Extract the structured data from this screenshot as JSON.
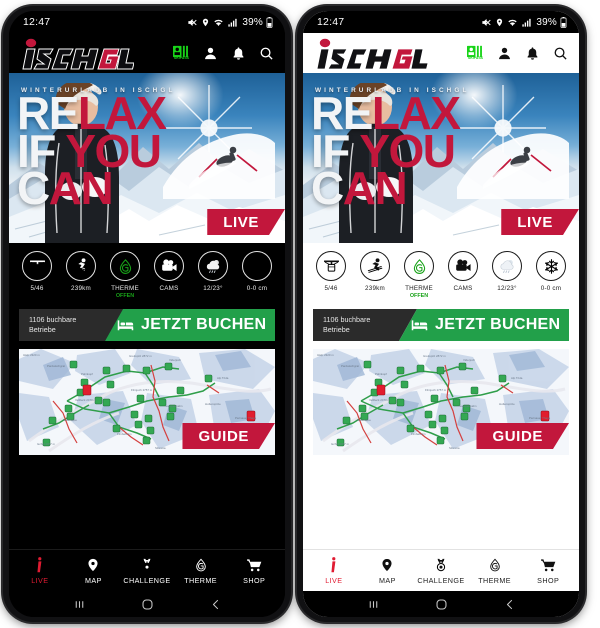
{
  "meta": {
    "layout": "two phone mockups side by side",
    "left_theme": "dark",
    "right_theme": "light"
  },
  "colors": {
    "brand_red": "#c2173c",
    "accent_red": "#e01b32",
    "book_green": "#22a04a",
    "skipass_green": "#18d418",
    "therme_green": "#18a218",
    "dark_bg": "#000000",
    "light_bg": "#ffffff"
  },
  "status_bar": {
    "time": "12:47",
    "battery_percent": "39%",
    "icons": [
      "mute-icon",
      "location-pin-icon",
      "wifi-icon",
      "signal-bars-icon",
      "battery-icon"
    ]
  },
  "app_header": {
    "logo_text": "ISCHGL",
    "icons": [
      {
        "name": "skipass-icon",
        "label": "SKIPASS"
      },
      {
        "name": "account-icon",
        "label": ""
      },
      {
        "name": "notification-bell-icon",
        "label": ""
      },
      {
        "name": "search-icon",
        "label": ""
      }
    ]
  },
  "hero": {
    "eyebrow": "WINTERURLAUB IN ISCHGL",
    "headline_lines": [
      {
        "white": "RE",
        "red": "LAX"
      },
      {
        "white": "IF ",
        "red": "YOU"
      },
      {
        "white": "C",
        "red": "AN"
      }
    ],
    "ribbon_label": "LIVE"
  },
  "stats": [
    {
      "icon": "gondola-lift-icon",
      "label": "5/46",
      "sub": ""
    },
    {
      "icon": "skier-icon",
      "label": "239km",
      "sub": ""
    },
    {
      "icon": "therme-drop-icon",
      "label": "THERME",
      "sub": "OFFEN"
    },
    {
      "icon": "video-camera-icon",
      "label": "CAMS",
      "sub": ""
    },
    {
      "icon": "weather-cloud-icon",
      "label": "12/23°",
      "sub": ""
    },
    {
      "icon": "snowflake-icon",
      "label": "0-0 cm",
      "sub": ""
    }
  ],
  "booking_bar": {
    "count_line1": "1106 buchbare",
    "count_line2": "Betriebe",
    "cta_label": "JETZT BUCHEN",
    "cta_icon": "bed-icon"
  },
  "map_card": {
    "ribbon_label": "GUIDE",
    "description": "ski piste panorama map with green lift markers and red highlight pins"
  },
  "bottom_nav": [
    {
      "icon": "live-info-icon",
      "label": "LIVE",
      "active": true
    },
    {
      "icon": "map-pin-icon",
      "label": "MAP",
      "active": false
    },
    {
      "icon": "medal-icon",
      "label": "CHALLENGE",
      "active": false
    },
    {
      "icon": "therme-drop-icon",
      "label": "THERME",
      "active": false
    },
    {
      "icon": "shopping-cart-icon",
      "label": "SHOP",
      "active": false
    }
  ],
  "android_nav": [
    {
      "icon": "recents-icon",
      "glyph": "|||"
    },
    {
      "icon": "home-icon",
      "glyph": "○"
    },
    {
      "icon": "back-icon",
      "glyph": "‹"
    }
  ]
}
